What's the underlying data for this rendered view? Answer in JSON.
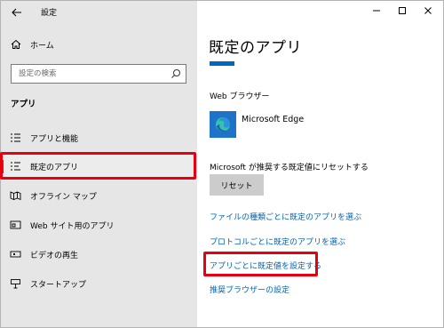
{
  "window": {
    "title": "設定",
    "controls": [
      "minimize",
      "maximize",
      "close"
    ]
  },
  "sidebar": {
    "home_label": "ホーム",
    "search_placeholder": "設定の検索",
    "section_label": "アプリ",
    "items": [
      {
        "label": "アプリと機能",
        "icon": "apps-list-icon",
        "selected": false
      },
      {
        "label": "既定のアプリ",
        "icon": "default-apps-icon",
        "selected": true
      },
      {
        "label": "オフライン マップ",
        "icon": "offline-map-icon",
        "selected": false
      },
      {
        "label": "Web サイト用のアプリ",
        "icon": "web-app-icon",
        "selected": false
      },
      {
        "label": "ビデオの再生",
        "icon": "video-icon",
        "selected": false
      },
      {
        "label": "スタートアップ",
        "icon": "startup-icon",
        "selected": false
      }
    ]
  },
  "main": {
    "title": "既定のアプリ",
    "web_browser_label": "Web ブラウザー",
    "browser_name": "Microsoft Edge",
    "reset_label": "Microsoft が推奨する既定値にリセットする",
    "reset_button": "リセット",
    "links": [
      "ファイルの種類ごとに既定のアプリを選ぶ",
      "プロトコルごとに既定のアプリを選ぶ",
      "アプリごとに既定値を設定する",
      "推奨ブラウザーの設定"
    ]
  },
  "colors": {
    "accent": "#0067c0",
    "link": "#0066b4",
    "highlight": "#e8000f",
    "sidebar_bg": "#e6e6e6"
  }
}
